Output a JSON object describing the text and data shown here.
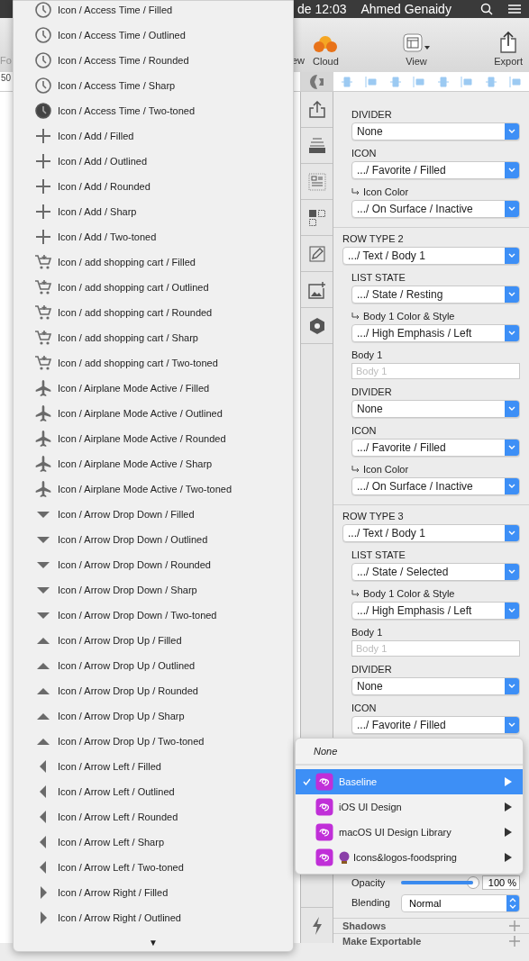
{
  "menubar": {
    "clock": "de 12:03",
    "user": "Ahmed Genaidy"
  },
  "toolbar": {
    "partial_left": "Fo",
    "partial_preview": "ew",
    "buttons": [
      {
        "label": "Cloud",
        "kind": "cloud"
      },
      {
        "label": "View",
        "kind": "view"
      },
      {
        "label": "Export",
        "kind": "export"
      }
    ]
  },
  "ruler": {
    "tick": "50"
  },
  "icon_menu": {
    "items": [
      {
        "label": "Icon / Access Time / Filled",
        "kind": "clock"
      },
      {
        "label": "Icon / Access Time / Outlined",
        "kind": "clock"
      },
      {
        "label": "Icon / Access Time / Rounded",
        "kind": "clock"
      },
      {
        "label": "Icon / Access Time / Sharp",
        "kind": "clock"
      },
      {
        "label": "Icon / Access Time / Two-toned",
        "kind": "darkclock"
      },
      {
        "label": "Icon / Add / Filled",
        "kind": "plus"
      },
      {
        "label": "Icon / Add / Outlined",
        "kind": "plus"
      },
      {
        "label": "Icon / Add / Rounded",
        "kind": "plus"
      },
      {
        "label": "Icon / Add / Sharp",
        "kind": "plus"
      },
      {
        "label": "Icon / Add / Two-toned",
        "kind": "plus"
      },
      {
        "label": "Icon / add shopping cart / Filled",
        "kind": "cart"
      },
      {
        "label": "Icon / add shopping cart / Outlined",
        "kind": "cart"
      },
      {
        "label": "Icon / add shopping cart / Rounded",
        "kind": "cart"
      },
      {
        "label": "Icon / add shopping cart / Sharp",
        "kind": "cart"
      },
      {
        "label": "Icon / add shopping cart / Two-toned",
        "kind": "cart"
      },
      {
        "label": "Icon / Airplane Mode Active / Filled",
        "kind": "airplane"
      },
      {
        "label": "Icon / Airplane Mode Active / Outlined",
        "kind": "airplane"
      },
      {
        "label": "Icon / Airplane Mode Active / Rounded",
        "kind": "airplane"
      },
      {
        "label": "Icon / Airplane Mode Active / Sharp",
        "kind": "airplane"
      },
      {
        "label": "Icon / Airplane Mode Active / Two-toned",
        "kind": "airplane"
      },
      {
        "label": "Icon / Arrow Drop Down / Filled",
        "kind": "down"
      },
      {
        "label": "Icon / Arrow Drop Down / Outlined",
        "kind": "down"
      },
      {
        "label": "Icon / Arrow Drop Down / Rounded",
        "kind": "down"
      },
      {
        "label": "Icon / Arrow Drop Down / Sharp",
        "kind": "down"
      },
      {
        "label": "Icon / Arrow Drop Down / Two-toned",
        "kind": "down"
      },
      {
        "label": "Icon / Arrow Drop Up / Filled",
        "kind": "up"
      },
      {
        "label": "Icon / Arrow Drop Up / Outlined",
        "kind": "up"
      },
      {
        "label": "Icon / Arrow Drop Up / Rounded",
        "kind": "up"
      },
      {
        "label": "Icon / Arrow Drop Up / Sharp",
        "kind": "up"
      },
      {
        "label": "Icon / Arrow Drop Up / Two-toned",
        "kind": "up"
      },
      {
        "label": "Icon / Arrow Left / Filled",
        "kind": "left"
      },
      {
        "label": "Icon / Arrow Left / Outlined",
        "kind": "left"
      },
      {
        "label": "Icon / Arrow Left / Rounded",
        "kind": "left"
      },
      {
        "label": "Icon / Arrow Left / Sharp",
        "kind": "left"
      },
      {
        "label": "Icon / Arrow Left / Two-toned",
        "kind": "left"
      },
      {
        "label": "Icon / Arrow Right / Filled",
        "kind": "right"
      },
      {
        "label": "Icon / Arrow Right / Outlined",
        "kind": "right"
      }
    ],
    "scroll_arrow": "▼"
  },
  "inspector": {
    "sections": [
      {
        "items": [
          {
            "kind": "label",
            "text": "DIVIDER"
          },
          {
            "kind": "select",
            "value": "None"
          },
          {
            "kind": "label",
            "text": "ICON"
          },
          {
            "kind": "select",
            "value": ".../ Favorite / Filled"
          },
          {
            "kind": "sublabel",
            "text": "Icon Color"
          },
          {
            "kind": "select",
            "value": ".../ On Surface / Inactive"
          }
        ]
      },
      {
        "title": "ROW TYPE 2",
        "value": ".../ Text / Body 1",
        "items": [
          {
            "kind": "label",
            "text": "LIST STATE"
          },
          {
            "kind": "select",
            "value": ".../ State / Resting"
          },
          {
            "kind": "sublabel",
            "text": "Body 1 Color & Style"
          },
          {
            "kind": "select",
            "value": ".../ High Emphasis / Left"
          },
          {
            "kind": "label",
            "text": "Body 1"
          },
          {
            "kind": "field",
            "placeholder": "Body 1"
          },
          {
            "kind": "label",
            "text": "DIVIDER"
          },
          {
            "kind": "select",
            "value": "None"
          },
          {
            "kind": "label",
            "text": "ICON"
          },
          {
            "kind": "select",
            "value": ".../ Favorite / Filled"
          },
          {
            "kind": "sublabel",
            "text": "Icon Color"
          },
          {
            "kind": "select",
            "value": ".../ On Surface / Inactive"
          }
        ]
      },
      {
        "title": "ROW TYPE 3",
        "value": ".../ Text / Body 1",
        "items": [
          {
            "kind": "label",
            "text": "LIST STATE"
          },
          {
            "kind": "select",
            "value": ".../ State / Selected"
          },
          {
            "kind": "sublabel",
            "text": "Body 1 Color & Style"
          },
          {
            "kind": "select",
            "value": ".../ High Emphasis / Left"
          },
          {
            "kind": "label",
            "text": "Body 1"
          },
          {
            "kind": "field",
            "placeholder": "Body 1"
          },
          {
            "kind": "label",
            "text": "DIVIDER"
          },
          {
            "kind": "select",
            "value": "None"
          },
          {
            "kind": "label",
            "text": "ICON"
          },
          {
            "kind": "select",
            "value": ".../ Favorite / Filled"
          }
        ]
      }
    ],
    "opacity": {
      "label": "Opacity",
      "level": 1,
      "value": "100 %"
    },
    "blending": {
      "label": "Blending",
      "value": "Normal"
    },
    "panels": [
      "Shadows",
      "Make Exportable"
    ]
  },
  "library_menu": {
    "none": "None",
    "items": [
      {
        "label": "Baseline",
        "selected": true,
        "orb": false
      },
      {
        "label": "iOS UI Design",
        "selected": false,
        "orb": false
      },
      {
        "label": "macOS UI Design Library",
        "selected": false,
        "orb": false
      },
      {
        "label": "Icons&logos-foodspring",
        "selected": false,
        "orb": true
      }
    ]
  }
}
